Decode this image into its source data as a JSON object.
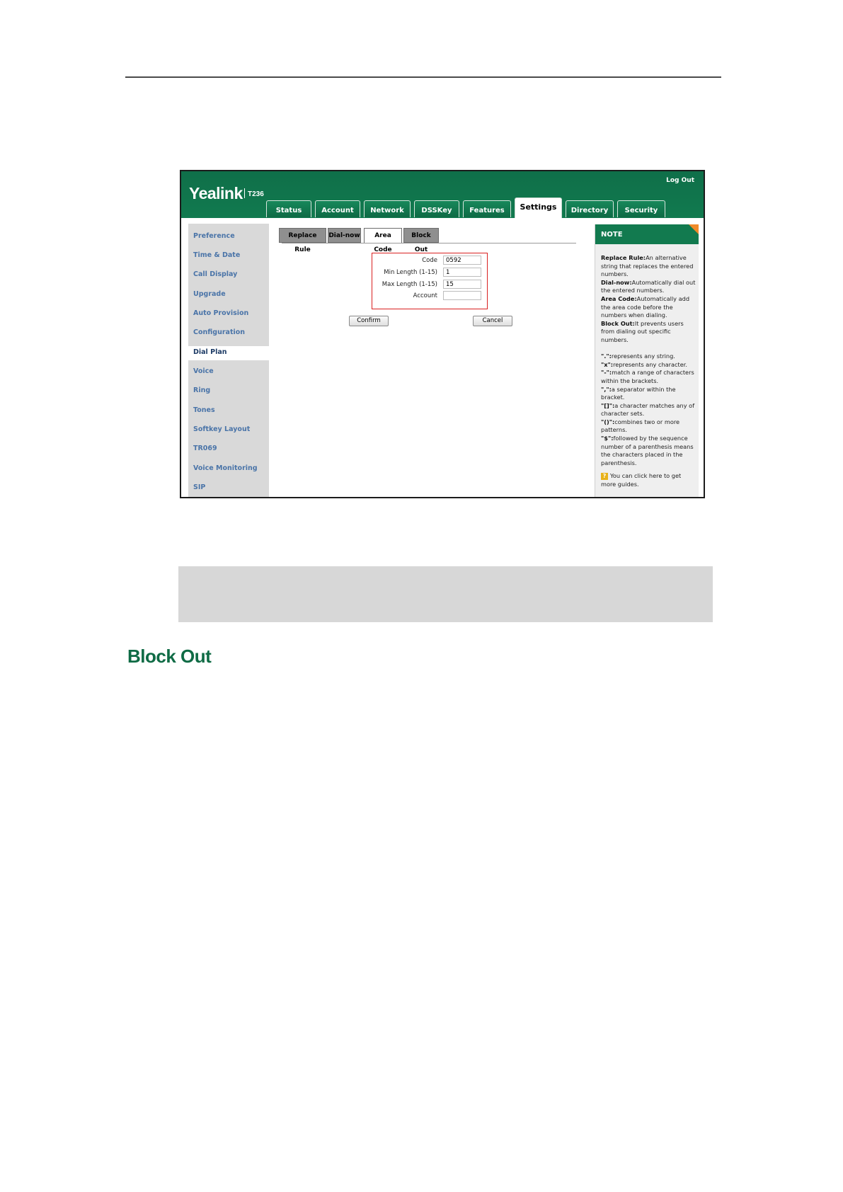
{
  "app": {
    "logo": "Yealink",
    "model": "T236",
    "logout_label": "Log Out"
  },
  "tabs": [
    {
      "label": "Status"
    },
    {
      "label": "Account"
    },
    {
      "label": "Network"
    },
    {
      "label": "DSSKey"
    },
    {
      "label": "Features"
    },
    {
      "label": "Settings",
      "active": true
    },
    {
      "label": "Directory"
    },
    {
      "label": "Security"
    }
  ],
  "sidebar": {
    "items": [
      {
        "label": "Preference"
      },
      {
        "label": "Time & Date"
      },
      {
        "label": "Call Display"
      },
      {
        "label": "Upgrade"
      },
      {
        "label": "Auto Provision"
      },
      {
        "label": "Configuration"
      },
      {
        "label": "Dial Plan",
        "active": true
      },
      {
        "label": "Voice"
      },
      {
        "label": "Ring"
      },
      {
        "label": "Tones"
      },
      {
        "label": "Softkey Layout"
      },
      {
        "label": "TR069"
      },
      {
        "label": "Voice Monitoring"
      },
      {
        "label": "SIP"
      }
    ]
  },
  "subtabs": [
    {
      "label": "Replace Rule"
    },
    {
      "label": "Dial-now"
    },
    {
      "label": "Area Code",
      "active": true
    },
    {
      "label": "Block Out"
    }
  ],
  "form": {
    "code_label": "Code",
    "code_value": "0592",
    "min_label": "Min Length (1-15)",
    "min_value": "1",
    "max_label": "Max Length (1-15)",
    "max_value": "15",
    "account_label": "Account",
    "account_value": "",
    "confirm_label": "Confirm",
    "cancel_label": "Cancel"
  },
  "note": {
    "title": "NOTE",
    "replace_rule_term": "Replace Rule:",
    "replace_rule_text": "An alternative string that replaces the entered numbers.",
    "dial_now_term": "Dial-now:",
    "dial_now_text": "Automatically dial out the entered numbers.",
    "area_code_term": "Area Code:",
    "area_code_text": "Automatically add the area code before the numbers when dialing.",
    "block_out_term": "Block Out:",
    "block_out_text": "It prevents users from dialing out specific numbers.",
    "dot_term": "\".\":",
    "dot_text": "represents any string.",
    "x_term": "\"x\":",
    "x_text": "represents any character.",
    "dash_term": "\"-\":",
    "dash_text": "match a range of characters within the brackets.",
    "comma_term": "\",\":",
    "comma_text": "a separator within the bracket.",
    "brackets_term": "\"[]\":",
    "brackets_text": "a character matches any of character sets.",
    "parens_term": "\"()\":",
    "parens_text": "combines two or more patterns.",
    "dollar_term": "\"$\":",
    "dollar_text": "followed by the sequence number of a parenthesis means the characters placed in the parenthesis.",
    "guide_text": "You can click here to get more guides.",
    "help_glyph": "?"
  },
  "page": {
    "section_heading": "Block Out"
  },
  "colors": {
    "brand_green": "#127a4f",
    "highlight_red": "#d92020",
    "note_corner": "#f08a2a"
  }
}
